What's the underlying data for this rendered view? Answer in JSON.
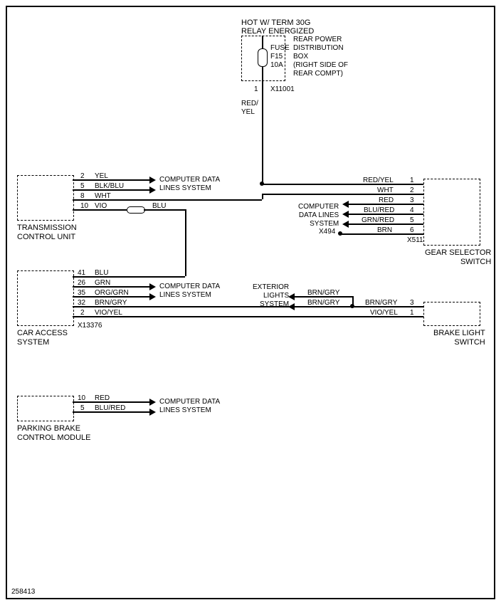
{
  "header": {
    "line1": "HOT W/ TERM 30G",
    "line2": "RELAY ENERGIZED"
  },
  "fuse": {
    "name": "FUSE",
    "id": "F15",
    "rating": "10A",
    "box": "REAR POWER\nDISTRIBUTION\nBOX\n(RIGHT SIDE OF\nREAR COMPT)",
    "conn_pin": "1",
    "conn_ref": "X11001",
    "wire_out": "RED/\nYEL"
  },
  "tcu": {
    "label": "TRANSMISSION\nCONTROL UNIT",
    "pins": [
      {
        "num": "2",
        "wire": "YEL"
      },
      {
        "num": "5",
        "wire": "BLK/BLU"
      },
      {
        "num": "8",
        "wire": "WHT"
      },
      {
        "num": "10",
        "wire": "VIO"
      }
    ],
    "arrow_text": "COMPUTER DATA\nLINES SYSTEM",
    "blu_label": "BLU"
  },
  "gear": {
    "label": "GEAR SELECTOR\nSWITCH",
    "pins": [
      {
        "num": "1",
        "wire": "RED/YEL"
      },
      {
        "num": "2",
        "wire": "WHT"
      },
      {
        "num": "3",
        "wire": "RED"
      },
      {
        "num": "4",
        "wire": "BLU/RED"
      },
      {
        "num": "5",
        "wire": "GRN/RED"
      },
      {
        "num": "6",
        "wire": "BRN"
      }
    ],
    "arrow_text": "COMPUTER\nDATA LINES\nSYSTEM",
    "x494": "X494",
    "x511": "X511"
  },
  "car_access": {
    "label": "CAR ACCESS\nSYSTEM",
    "pins": [
      {
        "num": "41",
        "wire": "BLU"
      },
      {
        "num": "26",
        "wire": "GRN"
      },
      {
        "num": "35",
        "wire": "ORG/GRN"
      },
      {
        "num": "32",
        "wire": "BRN/GRY"
      },
      {
        "num": "2",
        "wire": "VIO/YEL"
      }
    ],
    "arrow_text": "COMPUTER DATA\nLINES SYSTEM",
    "conn": "X13376"
  },
  "brake_light": {
    "label": "BRAKE LIGHT\nSWITCH",
    "pins": [
      {
        "num": "3",
        "wire": "BRN/GRY"
      },
      {
        "num": "1",
        "wire": "VIO/YEL"
      }
    ],
    "ext_lights": "EXTERIOR\nLIGHTS\nSYSTEM",
    "brn1": "BRN/GRY",
    "brn2": "BRN/GRY"
  },
  "parking_brake": {
    "label": "PARKING BRAKE\nCONTROL MODULE",
    "pins": [
      {
        "num": "10",
        "wire": "RED"
      },
      {
        "num": "5",
        "wire": "BLU/RED"
      }
    ],
    "arrow_text": "COMPUTER DATA\nLINES SYSTEM"
  },
  "docnum": "258413"
}
